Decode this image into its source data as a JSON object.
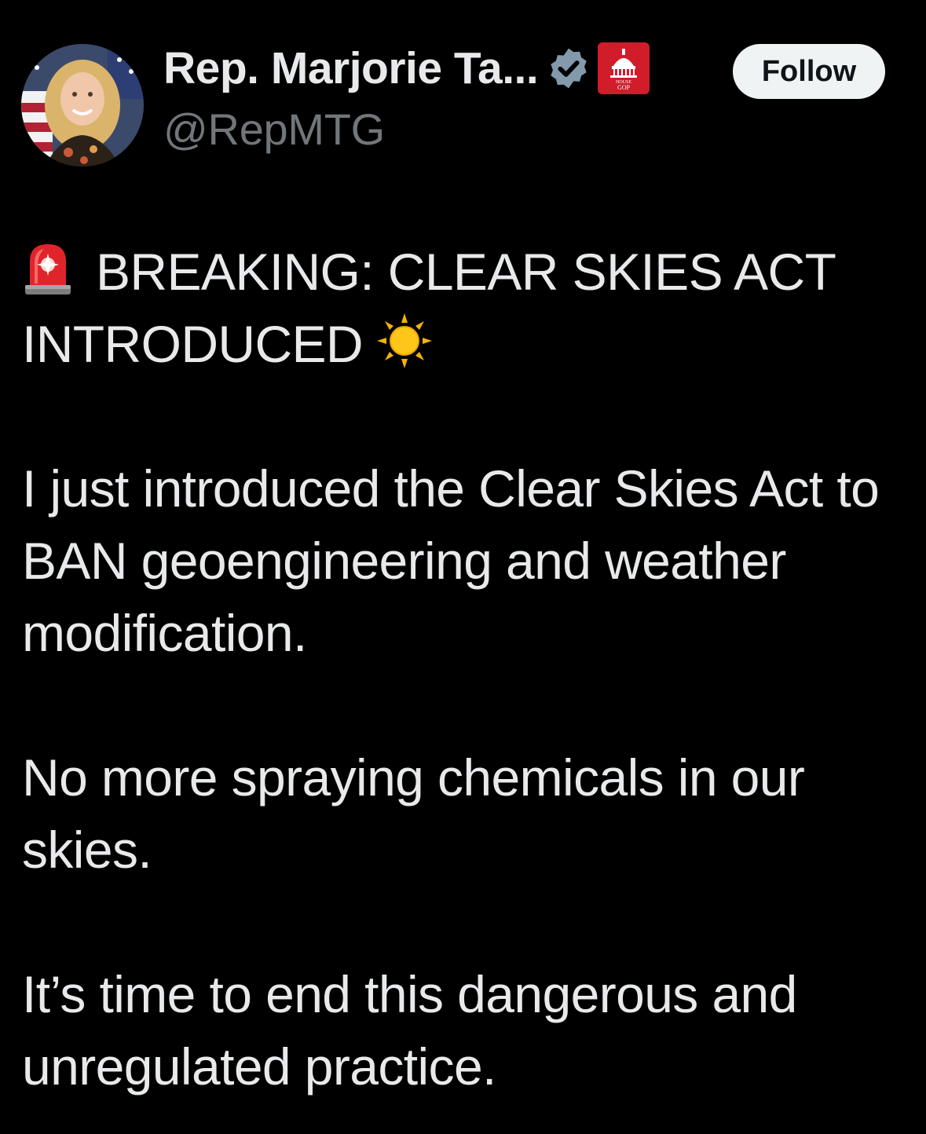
{
  "author": {
    "display_name": "Rep. Marjorie Ta...",
    "handle": "@RepMTG",
    "verified_icon": "verified-badge-icon",
    "affiliation_icon": "house-gop-badge-icon",
    "affiliation_badge_text": [
      "HOUSE",
      "GOP"
    ],
    "avatar": "avatar-photo"
  },
  "actions": {
    "follow_label": "Follow"
  },
  "tweet": {
    "headline_emoji": "police-car-light-icon",
    "headline_text": "BREAKING: CLEAR SKIES ACT INTRODUCED",
    "headline_trailing_emoji": "sun-icon",
    "paragraphs": [
      "I just introduced the Clear Skies Act to BAN geoengineering and weather modification.",
      "No more spraying chemicals in our skies.",
      "It’s time to end this dangerous and unregulated practice."
    ]
  },
  "colors": {
    "background": "#000000",
    "text_primary": "#e7e9ea",
    "text_secondary": "#71767b",
    "follow_bg": "#eff3f4",
    "follow_text": "#0f1419",
    "verified_badge": "#829aab",
    "affiliation_badge": "#d11c2a"
  }
}
